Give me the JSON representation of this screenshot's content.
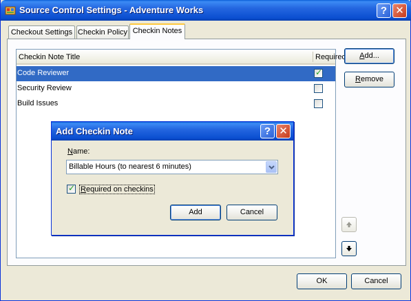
{
  "window": {
    "title": "Source Control Settings - Adventure Works",
    "help_glyph": "?",
    "close_glyph": "✕"
  },
  "tabs": [
    {
      "label": "Checkout Settings",
      "active": false
    },
    {
      "label": "Checkin Policy",
      "active": false
    },
    {
      "label": "Checkin Notes",
      "active": true
    }
  ],
  "notes_list": {
    "columns": {
      "title": "Checkin Note Title",
      "required": "Required"
    },
    "rows": [
      {
        "title": "Code Reviewer",
        "required": true,
        "selected": true
      },
      {
        "title": "Security Review",
        "required": false,
        "selected": false
      },
      {
        "title": "Build Issues",
        "required": false,
        "selected": false
      }
    ]
  },
  "side_buttons": {
    "add": {
      "pre": "",
      "mnemonic": "A",
      "post": "dd..."
    },
    "remove": {
      "pre": "",
      "mnemonic": "R",
      "post": "emove"
    },
    "move_up_icon": "arrow-up-icon",
    "move_down_icon": "arrow-down-icon"
  },
  "footer": {
    "ok": "OK",
    "cancel": "Cancel"
  },
  "dialog": {
    "title": "Add Checkin Note",
    "help_glyph": "?",
    "close_glyph": "✕",
    "name_label": {
      "pre": "",
      "mnemonic": "N",
      "post": "ame:"
    },
    "name_value": "Billable Hours (to nearest 6 minutes)",
    "required": {
      "checked": true,
      "pre": "",
      "mnemonic": "R",
      "post": "equired on checkins"
    },
    "add": "Add",
    "cancel": "Cancel"
  },
  "colors": {
    "title_blue": "#0a4ed0",
    "selection": "#316ac5",
    "face": "#ece9d8",
    "tab_highlight": "#ffc83c",
    "close_red": "#c63b1c"
  }
}
